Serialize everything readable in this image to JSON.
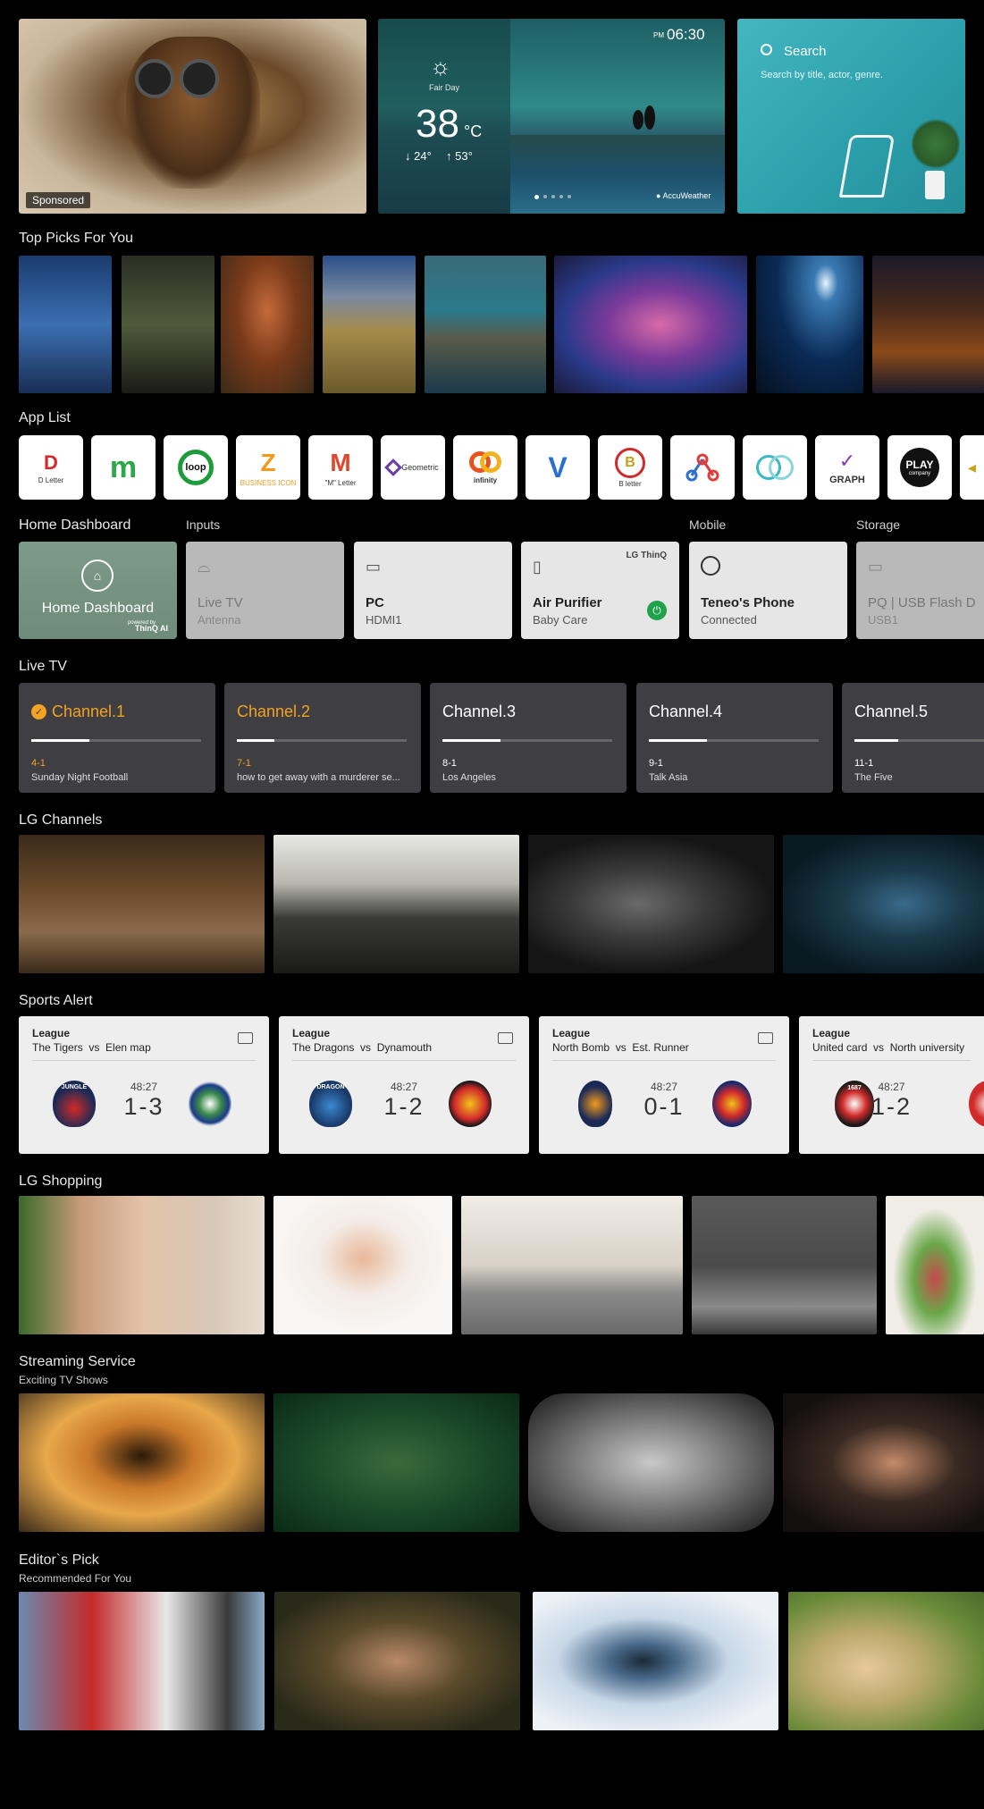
{
  "hero": {
    "sponsored_badge": "Sponsored",
    "weather": {
      "condition": "Fair Day",
      "temperature": "38",
      "unit": "°C",
      "low": "↓ 24°",
      "high": "↑ 53°",
      "time_period": "PM",
      "time": "06:30",
      "provider": "AccuWeather"
    },
    "search": {
      "label": "Search",
      "hint": "Search by title, actor, genre."
    }
  },
  "sections": {
    "top_picks": "Top Picks For You",
    "app_list": "App List",
    "live_tv": "Live TV",
    "lg_channels": "LG Channels",
    "sports_alert": "Sports Alert",
    "lg_shopping": "LG Shopping",
    "streaming": "Streaming Service",
    "streaming_sub": "Exciting TV Shows",
    "editors": "Editor`s Pick",
    "editors_sub": "Recommended For You"
  },
  "apps": [
    {
      "label": "D Letter",
      "color": "#d12a2a"
    },
    {
      "label": "",
      "color": "#2aa84a"
    },
    {
      "label": "loop",
      "color": "#1d9c3a"
    },
    {
      "label": "BUSINESS ICON",
      "color": "#f39a1d"
    },
    {
      "label": "\"M\" Letter",
      "color": "#e0462a"
    },
    {
      "label": "Geometric",
      "color": "#6a3ca8"
    },
    {
      "label": "infinity",
      "color": "#e8531d"
    },
    {
      "label": "",
      "color": "#2a6fd1"
    },
    {
      "label": "B letter",
      "color": "#c4a21d"
    },
    {
      "label": "",
      "color": "#e03a3a"
    },
    {
      "label": "",
      "color": "#3ab7c4"
    },
    {
      "label": "GRAPH",
      "color": "#8a3ab7"
    },
    {
      "label": "PLAY",
      "color": "#111111"
    }
  ],
  "dashboard": {
    "headers": {
      "home": "Home Dashboard",
      "inputs": "Inputs",
      "mobile": "Mobile",
      "storage": "Storage"
    },
    "home_card": {
      "title": "Home Dashboard",
      "powered": "powered by",
      "brand": "ThinQ AI"
    },
    "live_tv": {
      "title": "Live TV",
      "sub": "Antenna"
    },
    "pc": {
      "title": "PC",
      "sub": "HDMI1"
    },
    "purifier": {
      "title": "Air Purifier",
      "sub": "Baby Care",
      "badge": "LG ThinQ"
    },
    "phone": {
      "title": "Teneo's Phone",
      "sub": "Connected"
    },
    "usb": {
      "title": "PQ | USB Flash D",
      "sub": "USB1"
    }
  },
  "channels": [
    {
      "name": "Channel.1",
      "number": "4-1",
      "program": "Sunday Night Football",
      "progress": 0.34
    },
    {
      "name": "Channel.2",
      "number": "7-1",
      "program": "how to get away with a murderer se...",
      "progress": 0.22
    },
    {
      "name": "Channel.3",
      "number": "8-1",
      "program": "Los Angeles",
      "progress": 0.34
    },
    {
      "name": "Channel.4",
      "number": "9-1",
      "program": "Talk Asia",
      "progress": 0.34
    },
    {
      "name": "Channel.5",
      "number": "11-1",
      "program": "The Five",
      "progress": 0.34
    }
  ],
  "sports": [
    {
      "league": "League",
      "home": "The Tigers",
      "away": "Elen map",
      "vs": "vs",
      "time": "48:27",
      "score": "1-3"
    },
    {
      "league": "League",
      "home": "The Dragons",
      "away": "Dynamouth",
      "vs": "vs",
      "time": "48:27",
      "score": "1-2"
    },
    {
      "league": "League",
      "home": "North Bomb",
      "away": "Est. Runner",
      "vs": "vs",
      "time": "48:27",
      "score": "0-1"
    },
    {
      "league": "League",
      "home": "United card",
      "away": "North university",
      "vs": "vs",
      "time": "48:27",
      "score": "1-2"
    }
  ],
  "logos": {
    "jungle": "JUNGLE",
    "dragon": "DRAGON",
    "year": "1687",
    "play_sub": "company"
  }
}
